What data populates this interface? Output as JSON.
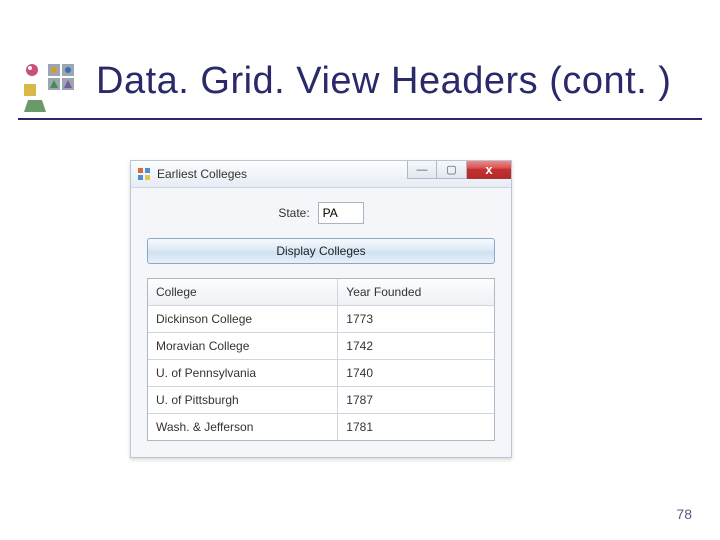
{
  "slide": {
    "title": "Data. Grid. View Headers (cont. )",
    "page_number": "78"
  },
  "window": {
    "title": "Earliest Colleges",
    "controls": {
      "minimize": "—",
      "maximize": "▢",
      "close": "x"
    },
    "state_label": "State:",
    "state_value": "PA",
    "button_label": "Display Colleges"
  },
  "grid": {
    "headers": {
      "col1": "College",
      "col2": "Year Founded"
    },
    "rows": [
      {
        "col1": "Dickinson College",
        "col2": "1773"
      },
      {
        "col1": "Moravian College",
        "col2": "1742"
      },
      {
        "col1": "U. of Pennsylvania",
        "col2": "1740"
      },
      {
        "col1": "U. of Pittsburgh",
        "col2": "1787"
      },
      {
        "col1": "Wash. & Jefferson",
        "col2": "1781"
      }
    ]
  }
}
